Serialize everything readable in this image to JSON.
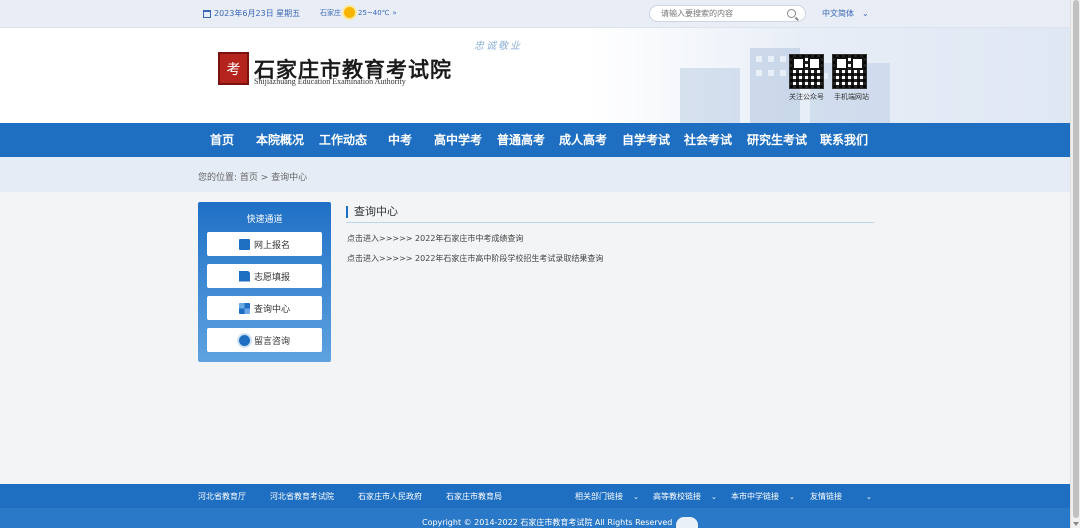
{
  "topbar": {
    "date": "2023年6月23日 星期五",
    "city": "石家庄",
    "temperature": "25~40℃",
    "search_placeholder": "请输入要搜索的内容",
    "language": "中文简体"
  },
  "header": {
    "slogan": "忠诚敬业",
    "seal": "考",
    "title": "石家庄市教育考试院",
    "subtitle": "Shijiazhuang Education Examination Authority",
    "qr_codes": [
      {
        "label": "关注公众号"
      },
      {
        "label": "手机端网站"
      }
    ]
  },
  "nav": {
    "items": [
      {
        "label": "首页"
      },
      {
        "label": "本院概况"
      },
      {
        "label": "工作动态"
      },
      {
        "label": "中考"
      },
      {
        "label": "高中学考"
      },
      {
        "label": "普通高考"
      },
      {
        "label": "成人高考"
      },
      {
        "label": "自学考试"
      },
      {
        "label": "社会考试"
      },
      {
        "label": "研究生考试"
      },
      {
        "label": "联系我们"
      }
    ]
  },
  "breadcrumb": "您的位置: 首页 > 查询中心",
  "sidebar": {
    "title": "快速通道",
    "items": [
      {
        "label": "网上报名",
        "icon": "signup-icon"
      },
      {
        "label": "志愿填报",
        "icon": "form-icon"
      },
      {
        "label": "查询中心",
        "icon": "query-icon"
      },
      {
        "label": "留言咨询",
        "icon": "chat-icon"
      }
    ]
  },
  "content": {
    "title": "查询中心",
    "links": [
      {
        "text": "点击进入>>>>> 2022年石家庄市中考成绩查询"
      },
      {
        "text": "点击进入>>>>> 2022年石家庄市高中阶段学校招生考试录取结果查询"
      }
    ]
  },
  "footer": {
    "links": [
      {
        "label": "河北省教育厅"
      },
      {
        "label": "河北省教育考试院"
      },
      {
        "label": "石家庄市人民政府"
      },
      {
        "label": "石家庄市教育局"
      }
    ],
    "selects": [
      {
        "label": "相关部门链接"
      },
      {
        "label": "高等教校链接"
      },
      {
        "label": "本市中学链接"
      },
      {
        "label": "友情链接"
      }
    ],
    "copyright": "Copyright © 2014-2022 石家庄市教育考试院 All Rights Reserved"
  },
  "colors": {
    "primary": "#1e6fc2",
    "seal": "#b5241c"
  }
}
